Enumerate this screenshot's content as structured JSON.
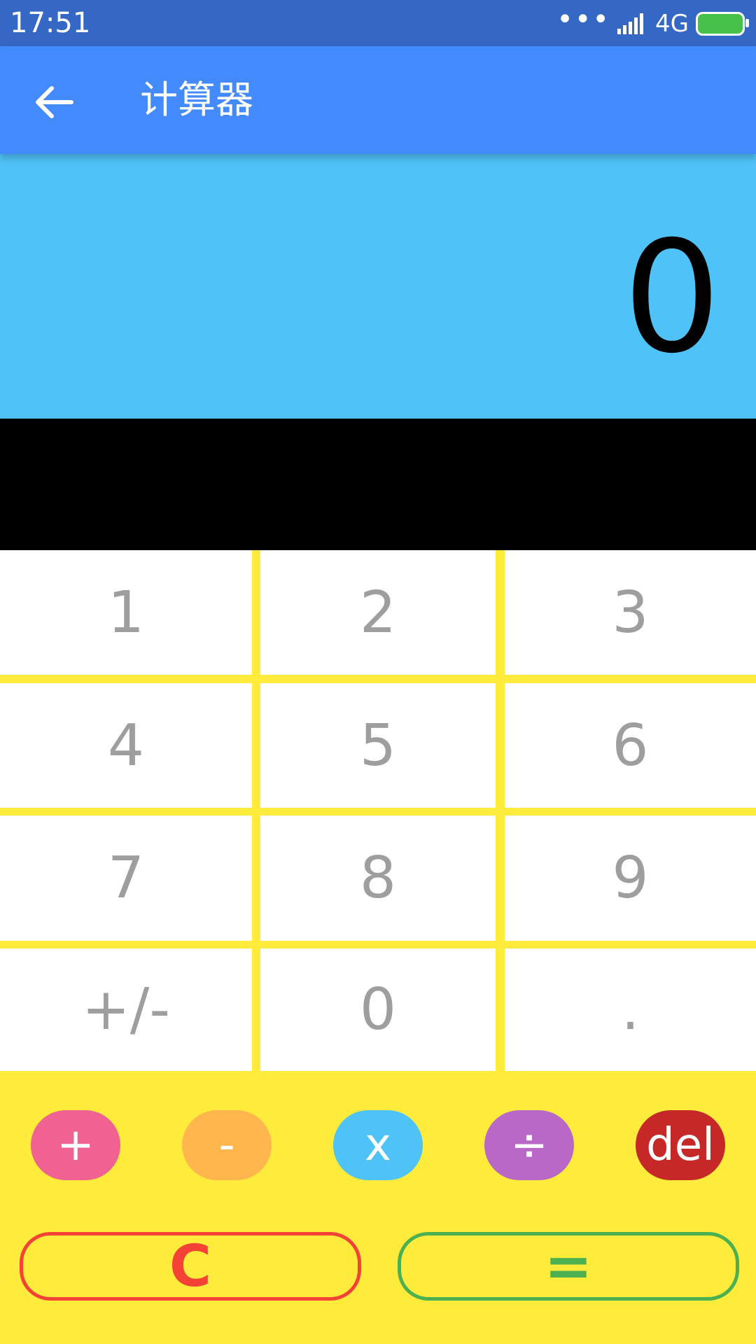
{
  "status": {
    "time": "17:51",
    "dots": "•••",
    "network": "4G"
  },
  "header": {
    "title": "计算器"
  },
  "display": {
    "value": "0"
  },
  "keypad": {
    "rows": [
      [
        "1",
        "2",
        "3"
      ],
      [
        "4",
        "5",
        "6"
      ],
      [
        "7",
        "8",
        "9"
      ],
      [
        "+/-",
        "0",
        "."
      ]
    ]
  },
  "operators": [
    "+",
    "-",
    "x",
    "÷",
    "del"
  ],
  "actions": {
    "clear": "C",
    "equals": "="
  },
  "colors": {
    "status_bar": "#3468c4",
    "app_bar": "#448aff",
    "display_bg": "#4fc3f7",
    "keypad_bg": "#ffeb3b",
    "key_text": "#9e9e9e",
    "op_plus": "#f06292",
    "op_minus": "#ffb74d",
    "op_multiply": "#4fc3f7",
    "op_divide": "#ba68c8",
    "op_del": "#c62828",
    "clear_border": "#f44336",
    "equals_border": "#4caf50"
  },
  "icons": {
    "back": "arrow-left-icon",
    "battery": "battery-charging-icon",
    "signal": "signal-icon"
  }
}
